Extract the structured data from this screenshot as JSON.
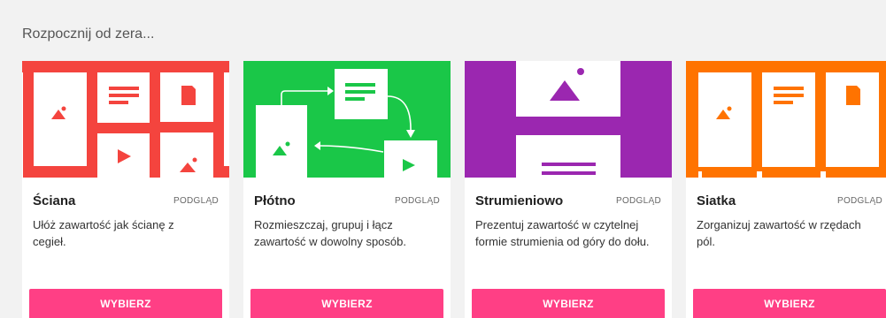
{
  "heading": "Rozpocznij od zera...",
  "cards": [
    {
      "title": "Ściana",
      "preview": "PODGLĄD",
      "description": "Ułóż zawartość jak ścianę z cegieł.",
      "button": "WYBIERZ",
      "color": "#f4443e"
    },
    {
      "title": "Płótno",
      "preview": "PODGLĄD",
      "description": "Rozmieszczaj, grupuj i łącz zawartość w dowolny sposób.",
      "button": "WYBIERZ",
      "color": "#1ac748"
    },
    {
      "title": "Strumieniowo",
      "preview": "PODGLĄD",
      "description": "Prezentuj zawartość w czytelnej formie strumienia od góry do dołu.",
      "button": "WYBIERZ",
      "color": "#9b27b0"
    },
    {
      "title": "Siatka",
      "preview": "PODGLĄD",
      "description": "Zorganizuj zawartość w rzędach pól.",
      "button": "WYBIERZ",
      "color": "#ff7300"
    }
  ],
  "colors": {
    "button": "#ff3f85",
    "background": "#f2f2f2"
  }
}
